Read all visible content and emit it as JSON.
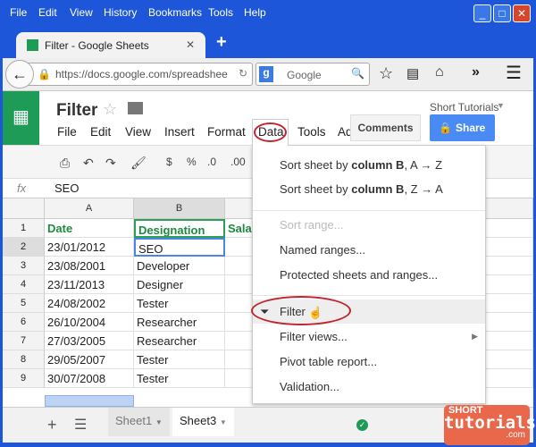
{
  "browser": {
    "menu": [
      "File",
      "Edit",
      "View",
      "History",
      "Bookmarks",
      "Tools",
      "Help"
    ],
    "tab_title": "Filter - Google Sheets",
    "url": "https://docs.google.com/spreadshee",
    "search_placeholder": "Google"
  },
  "doc": {
    "title": "Filter",
    "user": "Short Tutorials",
    "menu": [
      "File",
      "Edit",
      "View",
      "Insert",
      "Format",
      "Data",
      "Tools",
      "Ad"
    ],
    "comments": "Comments",
    "share": "Share",
    "toolbar": {
      "currency": "$",
      "percent": "%",
      "dec_decrease": ".0",
      "dec_increase": ".00"
    }
  },
  "formula_bar": {
    "fx": "fx",
    "value": "SEO"
  },
  "grid": {
    "columns": [
      "A",
      "B"
    ],
    "headers": [
      "Date",
      "Designation",
      "Sala"
    ],
    "rows": [
      {
        "n": "1"
      },
      {
        "n": "2",
        "a": "23/01/2012",
        "b": "SEO"
      },
      {
        "n": "3",
        "a": "23/08/2001",
        "b": "Developer"
      },
      {
        "n": "4",
        "a": "23/11/2013",
        "b": "Designer"
      },
      {
        "n": "5",
        "a": "24/08/2002",
        "b": "Tester"
      },
      {
        "n": "6",
        "a": "26/10/2004",
        "b": "Researcher"
      },
      {
        "n": "7",
        "a": "27/03/2005",
        "b": "Researcher"
      },
      {
        "n": "8",
        "a": "29/05/2007",
        "b": "Tester"
      },
      {
        "n": "9",
        "a": "30/07/2008",
        "b": "Tester"
      }
    ]
  },
  "data_menu": {
    "sort_az": {
      "pre": "Sort sheet by ",
      "bold": "column B",
      ",post": "",
      "post": ", A → Z"
    },
    "sort_za": {
      "pre": "Sort sheet by ",
      "bold": "column B",
      "post": ", Z → A"
    },
    "sort_range": "Sort range...",
    "named_ranges": "Named ranges...",
    "protected": "Protected sheets and ranges...",
    "filter": "Filter",
    "filter_views": "Filter views...",
    "pivot": "Pivot table report...",
    "validation": "Validation..."
  },
  "sheets": [
    "Sheet1",
    "Sheet3"
  ],
  "brand": {
    "line1": "SHORT",
    "line2": "tutorials",
    "line3": ".com"
  },
  "colors": {
    "green": "#1e9c57",
    "share": "#4285f4",
    "highlight": "#c0262c"
  }
}
